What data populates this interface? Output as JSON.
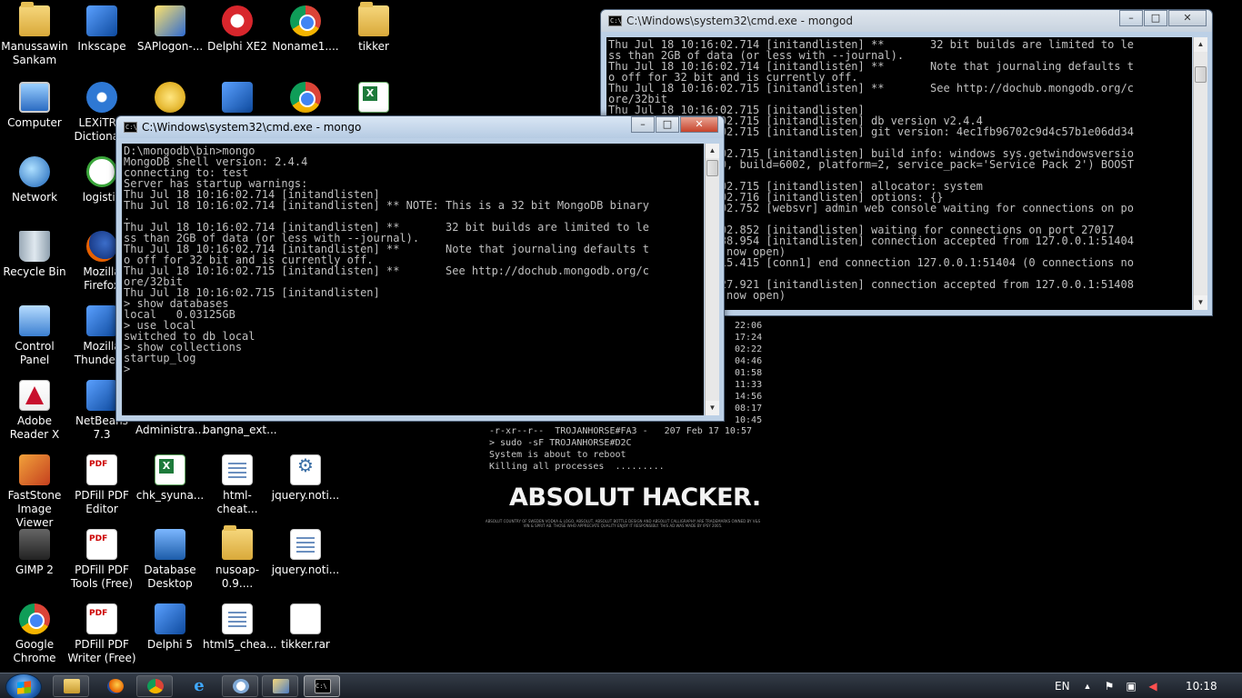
{
  "desktop": {
    "icons": [
      {
        "label": "Manussawin\nSankam",
        "icon": "folder-user-icon"
      },
      {
        "label": "Inkscape",
        "icon": "inkscape-icon"
      },
      {
        "label": "SAPlogon-...",
        "icon": "sap-icon"
      },
      {
        "label": "Delphi XE2",
        "icon": "delphi-icon"
      },
      {
        "label": "Noname1....",
        "icon": "chrome-icon"
      },
      {
        "label": "tikker",
        "icon": "folder-icon"
      },
      {
        "label": "Computer",
        "icon": "computer-icon"
      },
      {
        "label": "LEXiTRO\nDictiona...",
        "icon": "lexitron-icon"
      },
      {
        "label": "Network",
        "icon": "network-icon"
      },
      {
        "label": "logistic",
        "icon": "logistic-icon"
      },
      {
        "label": "Recycle Bin",
        "icon": "recycle-bin-icon"
      },
      {
        "label": "Mozilla\nFirefox",
        "icon": "firefox-icon"
      },
      {
        "label": "Control\nPanel",
        "icon": "control-panel-icon"
      },
      {
        "label": "Mozilla\nThunder...",
        "icon": "thunderbird-icon"
      },
      {
        "label": "Adobe\nReader X",
        "icon": "adobe-reader-icon"
      },
      {
        "label": "NetBeans\n7.3",
        "icon": "netbeans-icon"
      },
      {
        "label": "Administra...",
        "icon": "excel-icon"
      },
      {
        "label": "bangna_ext...",
        "icon": "excel-icon"
      },
      {
        "label": "FastStone\nImage Viewer",
        "icon": "faststone-icon"
      },
      {
        "label": "PDFill PDF\nEditor",
        "icon": "pdf-icon"
      },
      {
        "label": "chk_syuna...",
        "icon": "excel-icon"
      },
      {
        "label": "html-cheat...",
        "icon": "document-icon"
      },
      {
        "label": "jquery.noti...",
        "icon": "script-icon"
      },
      {
        "label": "GIMP 2",
        "icon": "gimp-icon"
      },
      {
        "label": "PDFill PDF\nTools (Free)",
        "icon": "pdf-icon"
      },
      {
        "label": "Database\nDesktop",
        "icon": "database-icon"
      },
      {
        "label": "nusoap-0.9....",
        "icon": "zip-folder-icon"
      },
      {
        "label": "jquery.noti...",
        "icon": "script-icon"
      },
      {
        "label": "Google\nChrome",
        "icon": "chrome-icon"
      },
      {
        "label": "PDFill PDF\nWriter (Free)",
        "icon": "pdf-icon"
      },
      {
        "label": "Delphi 5",
        "icon": "delphi5-icon"
      },
      {
        "label": "html5_chea...",
        "icon": "document-icon"
      },
      {
        "label": "tikker.rar",
        "icon": "archive-icon"
      }
    ],
    "unlabeled_icons": [
      "money-icon",
      "installer-icon",
      "chrome-icon",
      "excel-icon"
    ]
  },
  "wallpaper": {
    "times": [
      "22:06",
      "17:24",
      "02:22",
      "04:46",
      "01:58",
      "11:33",
      "14:56",
      "08:17",
      "10:45"
    ],
    "listing": "-r-xr--r--  TROJANHORSE#FA3 -   207 Feb 17 10:57",
    "cmd1": "> sudo -sF TROJANHORSE#D2C",
    "cmd2": "System is about to reboot",
    "cmd3": "Killing all processes  .........",
    "title": "ABSOLUT HACKER.",
    "fine_print": "ABSOLUT COUNTRY OF SWEDEN VODKA & LOGO, ABSOLUT, ABSOLUT BOTTLE DESIGN AND ABSOLUT CALLIGRAPHY ARE TRADEMARKS OWNED BY V&S VIN & SPRIT AB. THOSE WHO APPRECIATE QUALITY ENJOY IT RESPONSIBLY. THIS AD WAS MADE BY IPSY 2005."
  },
  "window_mongod": {
    "title": "C:\\Windows\\system32\\cmd.exe - mongod",
    "console": "Thu Jul 18 10:16:02.714 [initandlisten] **       32 bit builds are limited to le\nss than 2GB of data (or less with --journal).\nThu Jul 18 10:16:02.714 [initandlisten] **       Note that journaling defaults t\no off for 32 bit and is currently off.\nThu Jul 18 10:16:02.715 [initandlisten] **       See http://dochub.mongodb.org/c\nore/32bit\nThu Jul 18 10:16:02.715 [initandlisten]\nThu Jul 18 10:16:02.715 [initandlisten] db version v2.4.4\nThu Jul 18 10:16:02.715 [initandlisten] git version: 4ec1fb96702c9d4c57b1e06dd34\n\nThu Jul 18 10:16:02.715 [initandlisten] build info: windows sys.getwindowsversio\nn(major=6, minor=0, build=6002, platform=2, service_pack='Service Pack 2') BOOST\n\nThu Jul 18 10:16:02.715 [initandlisten] allocator: system\nThu Jul 18 10:16:02.716 [initandlisten] options: {}\nThu Jul 18 10:16:02.752 [websvr] admin web console waiting for connections on po\n\nThu Jul 18 10:16:02.852 [initandlisten] waiting for connections on port 27017\nThu Jul 18 10:16:38.954 [initandlisten] connection accepted from 127.0.0.1:51404\n #1 (1 connection now open)\nThu Jul 18 10:17:15.415 [conn1] end connection 127.0.0.1:51404 (0 connections no\n\nThu Jul 18 10:17:27.921 [initandlisten] connection accepted from 127.0.0.1:51408\n #2 (1 connection now open)"
  },
  "window_mongo": {
    "title": "C:\\Windows\\system32\\cmd.exe - mongo",
    "console": "D:\\mongodb\\bin>mongo\nMongoDB shell version: 2.4.4\nconnecting to: test\nServer has startup warnings:\nThu Jul 18 10:16:02.714 [initandlisten]\nThu Jul 18 10:16:02.714 [initandlisten] ** NOTE: This is a 32 bit MongoDB binary\n.\nThu Jul 18 10:16:02.714 [initandlisten] **       32 bit builds are limited to le\nss than 2GB of data (or less with --journal).\nThu Jul 18 10:16:02.714 [initandlisten] **       Note that journaling defaults t\no off for 32 bit and is currently off.\nThu Jul 18 10:16:02.715 [initandlisten] **       See http://dochub.mongodb.org/c\nore/32bit\nThu Jul 18 10:16:02.715 [initandlisten]\n> show databases\nlocal   0.03125GB\n> use local\nswitched to db local\n> show collections\nstartup_log\n>"
  },
  "window_controls": {
    "minimize": "–",
    "maximize": "□",
    "close": "✕"
  },
  "taskbar": {
    "buttons": [
      "windows-explorer",
      "firefox",
      "chrome",
      "internet-explorer",
      "messenger",
      "file-manager",
      "cmd"
    ],
    "language": "EN",
    "clock": "10:18"
  }
}
